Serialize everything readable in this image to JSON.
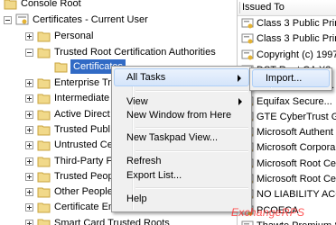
{
  "tree": {
    "console_root": "Console Root",
    "certificates_root": "Certificates - Current User",
    "personal": "Personal",
    "trusted_root": "Trusted Root Certification Authorities",
    "certificates": "Certificates",
    "items": [
      "Enterprise Tru",
      "Intermediate",
      "Active Direct",
      "Trusted Publ",
      "Untrusted Ce",
      "Third-Party F",
      "Trusted Peop",
      "Other People",
      "Certificate En",
      "Smart Card Trusted Roots"
    ]
  },
  "right_pane": {
    "column_header": "Issued To",
    "certs": [
      "Class 3 Public Prim",
      "Class 3 Public Prim",
      "Copyright (c) 1997",
      "DST Root CA X3",
      "Entrust.net Cert...",
      "Equifax Secure...",
      "GTE CyberTrust Glo",
      "Microsoft Authent",
      "Microsoft Corpora",
      "Microsoft Root Ce",
      "Microsoft Root Ce",
      "NO LIABILITY ACC",
      "PCOECA",
      "Thawte Premium Se"
    ]
  },
  "context_menu": {
    "all_tasks": "All Tasks",
    "view": "View",
    "new_window": "New Window from Here",
    "new_taskpad": "New Taskpad View...",
    "refresh": "Refresh",
    "export_list": "Export List...",
    "help": "Help"
  },
  "submenu": {
    "import": "Import..."
  },
  "watermark": "ExchangeRPS"
}
